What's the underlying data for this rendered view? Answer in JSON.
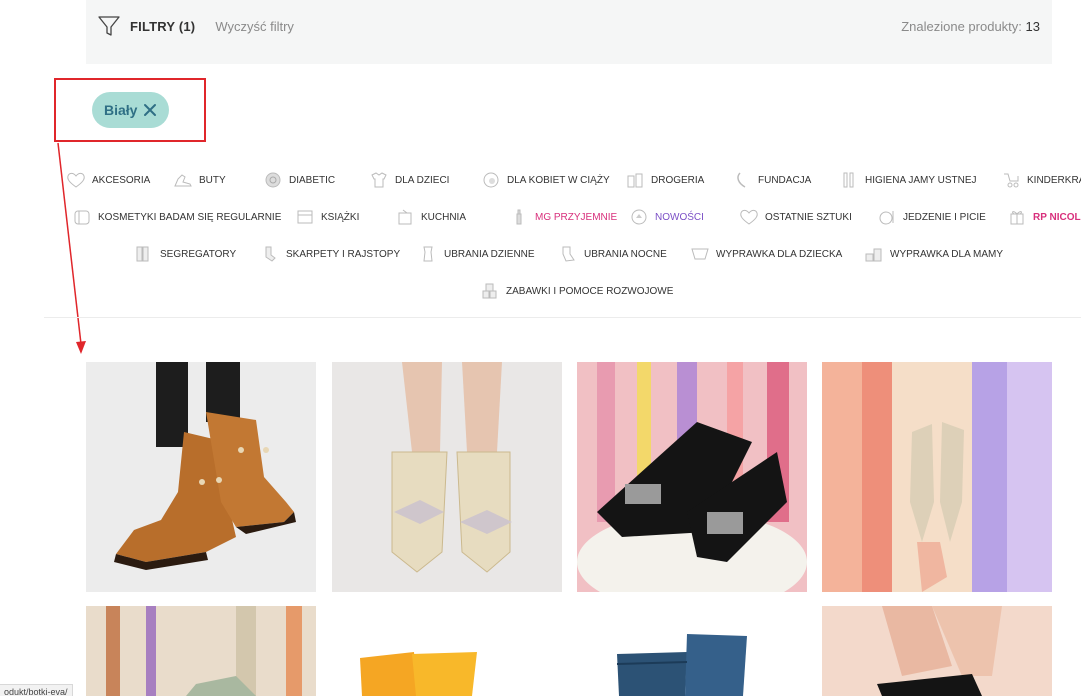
{
  "filter_bar": {
    "filters_label": "FILTRY (1)",
    "clear_label": "Wyczyść filtry",
    "found_label": "Znalezione produkty:",
    "found_count": "13"
  },
  "active_filter": {
    "label": "Biały"
  },
  "categories": {
    "row1": [
      "AKCESORIA",
      "BUTY",
      "DIABETIC",
      "DLA DZIECI",
      "DLA KOBIET W CIĄŻY",
      "DROGERIA",
      "FUNDACJA",
      "HIGIENA JAMY USTNEJ",
      "KINDERKRAFT"
    ],
    "row2": [
      "KOSMETYKI BADAM SIĘ REGULARNIE",
      "KSIĄŻKI",
      "KUCHNIA",
      "MG PRZYJEMNIE",
      "NOWOŚCI",
      "OSTATNIE SZTUKI",
      "JEDZENIE I PICIE",
      "RP NICOLE"
    ],
    "row3": [
      "SEGREGATORY",
      "SKARPETY I RAJSTOPY",
      "UBRANIA DZIENNE",
      "UBRANIA NOCNE",
      "WYPRAWKA DLA DZIECKA",
      "WYPRAWKA DLA MAMY"
    ],
    "row4": [
      "ZABAWKI I POMOCE ROZWOJOWE"
    ]
  },
  "colors": {
    "chip_bg": "#a9dcd5",
    "chip_text": "#2f6f85",
    "highlight": "#e0262b",
    "pink_category": "#d8307c",
    "purple_category": "#7b4fc6"
  },
  "status_bar": {
    "url": "odukt/botki-eva/"
  }
}
